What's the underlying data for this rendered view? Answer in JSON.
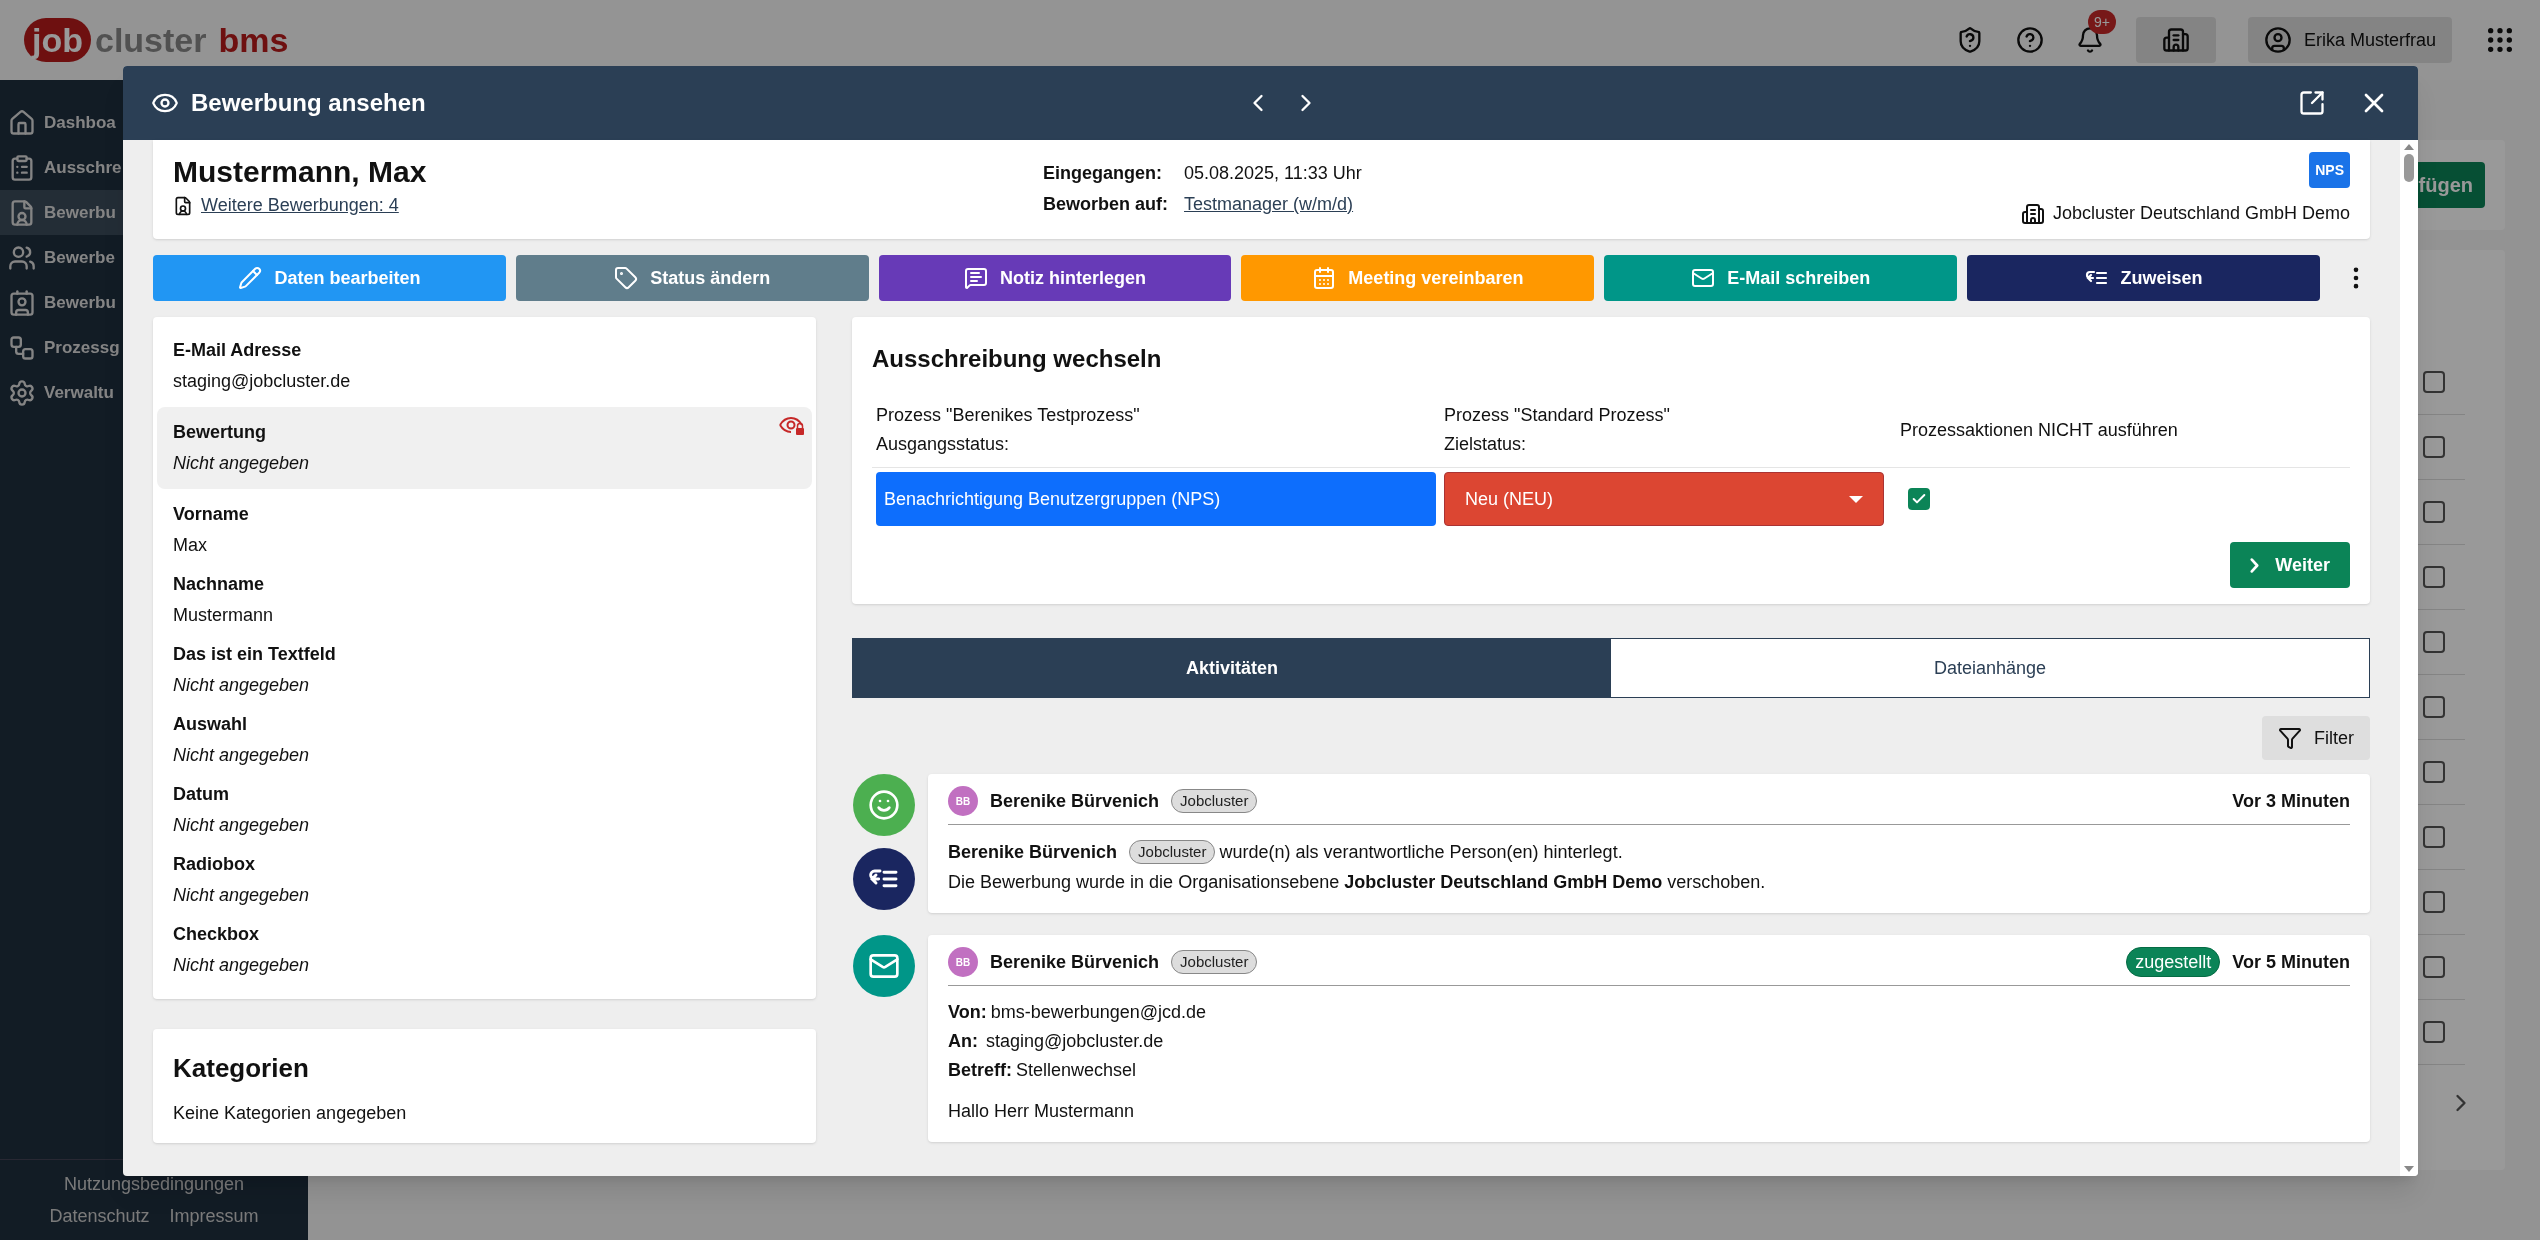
{
  "app": {
    "logo": {
      "part1": "job",
      "part2": "cluster",
      "part3": "bms"
    },
    "notifications_badge": "9+",
    "user": "Erika Musterfrau",
    "sidebar": [
      {
        "label": "Dashboa",
        "selected": false
      },
      {
        "label": "Ausschre",
        "selected": false
      },
      {
        "label": "Bewerbu",
        "selected": true
      },
      {
        "label": "Bewerbe",
        "selected": false
      },
      {
        "label": "Bewerbu",
        "selected": false
      },
      {
        "label": "Prozessg",
        "selected": false
      },
      {
        "label": "Verwaltu",
        "selected": false
      }
    ],
    "footer_links": [
      "Nutzungsbedingungen",
      "Datenschutz",
      "Impressum"
    ],
    "background_button": "fügen",
    "background_rows": [
      {
        "checked": false
      },
      {
        "checked": false
      },
      {
        "checked": false
      },
      {
        "checked": false
      },
      {
        "checked": false
      },
      {
        "checked": false
      },
      {
        "checked": false
      },
      {
        "checked": false
      },
      {
        "checked": false
      },
      {
        "checked": false
      },
      {
        "checked": false
      }
    ]
  },
  "modal": {
    "title": "Bewerbung ansehen",
    "applicant": {
      "name": "Mustermann, Max",
      "more_link": "Weitere Bewerbungen: 4",
      "received_label": "Eingegangen:",
      "received": "05.08.2025, 11:33 Uhr",
      "applied_label": "Beworben auf:",
      "applied": "Testmanager (w/m/d)",
      "badge": "NPS",
      "organization": "Jobcluster Deutschland GmbH Demo"
    },
    "actions": [
      {
        "label": "Daten bearbeiten",
        "color": "#2196f3"
      },
      {
        "label": "Status ändern",
        "color": "#607d8b"
      },
      {
        "label": "Notiz hinterlegen",
        "color": "#673ab7"
      },
      {
        "label": "Meeting vereinbaren",
        "color": "#ff9800"
      },
      {
        "label": "E-Mail schreiben",
        "color": "#009688"
      },
      {
        "label": "Zuweisen",
        "color": "#1a2660"
      }
    ],
    "fields": [
      {
        "label": "E-Mail Adresse",
        "value": "staging@jobcluster.de",
        "empty": false,
        "restricted": false
      },
      {
        "label": "Bewertung",
        "value": "Nicht angegeben",
        "empty": true,
        "restricted": true
      },
      {
        "label": "Vorname",
        "value": "Max",
        "empty": false,
        "restricted": false
      },
      {
        "label": "Nachname",
        "value": "Mustermann",
        "empty": false,
        "restricted": false
      },
      {
        "label": "Das ist ein Textfeld",
        "value": "Nicht angegeben",
        "empty": true,
        "restricted": false
      },
      {
        "label": "Auswahl",
        "value": "Nicht angegeben",
        "empty": true,
        "restricted": false
      },
      {
        "label": "Datum",
        "value": "Nicht angegeben",
        "empty": true,
        "restricted": false
      },
      {
        "label": "Radiobox",
        "value": "Nicht angegeben",
        "empty": true,
        "restricted": false
      },
      {
        "label": "Checkbox",
        "value": "Nicht angegeben",
        "empty": true,
        "restricted": false
      }
    ],
    "categories": {
      "title": "Kategorien",
      "text": "Keine Kategorien angegeben"
    },
    "switch": {
      "title": "Ausschreibung wechseln",
      "source_process": "Prozess \"Berenikes Testprozess\"",
      "source_label": "Ausgangsstatus:",
      "target_process": "Prozess \"Standard Prozess\"",
      "target_label": "Zielstatus:",
      "skip_label": "Prozessaktionen NICHT ausführen",
      "source_status": "Benachrichtigung Benutzergruppen (NPS)",
      "target_status": "Neu (NEU)",
      "skip_checked": true,
      "button": "Weiter"
    },
    "tabs": [
      {
        "label": "Aktivitäten",
        "selected": true
      },
      {
        "label": "Dateianhänge",
        "selected": false
      }
    ],
    "filter": "Filter",
    "activities": [
      {
        "kind": "assignment",
        "initials": "BB",
        "author": "Berenike Bürvenich",
        "tag": "Jobcluster",
        "time": "Vor 3 Minuten",
        "mention_name": "Berenike Bürvenich",
        "mention_tag": "Jobcluster",
        "mention_text": "wurde(n) als verantwortliche Person(en) hinterlegt.",
        "text": "Die Bewerbung wurde in die Organisationsebene **Jobcluster Deutschland GmbH Demo** verschoben."
      },
      {
        "kind": "email",
        "initials": "BB",
        "author": "Berenike Bürvenich",
        "tag": "Jobcluster",
        "status": "zugestellt",
        "time": "Vor 5 Minuten",
        "from_label": "Von:",
        "from": "bms-bewerbungen@jcd.de",
        "to_label": "An:",
        "to": "staging@jobcluster.de",
        "subject_label": "Betreff:",
        "subject": "Stellenwechsel",
        "body": "Hallo Herr Mustermann"
      }
    ]
  }
}
